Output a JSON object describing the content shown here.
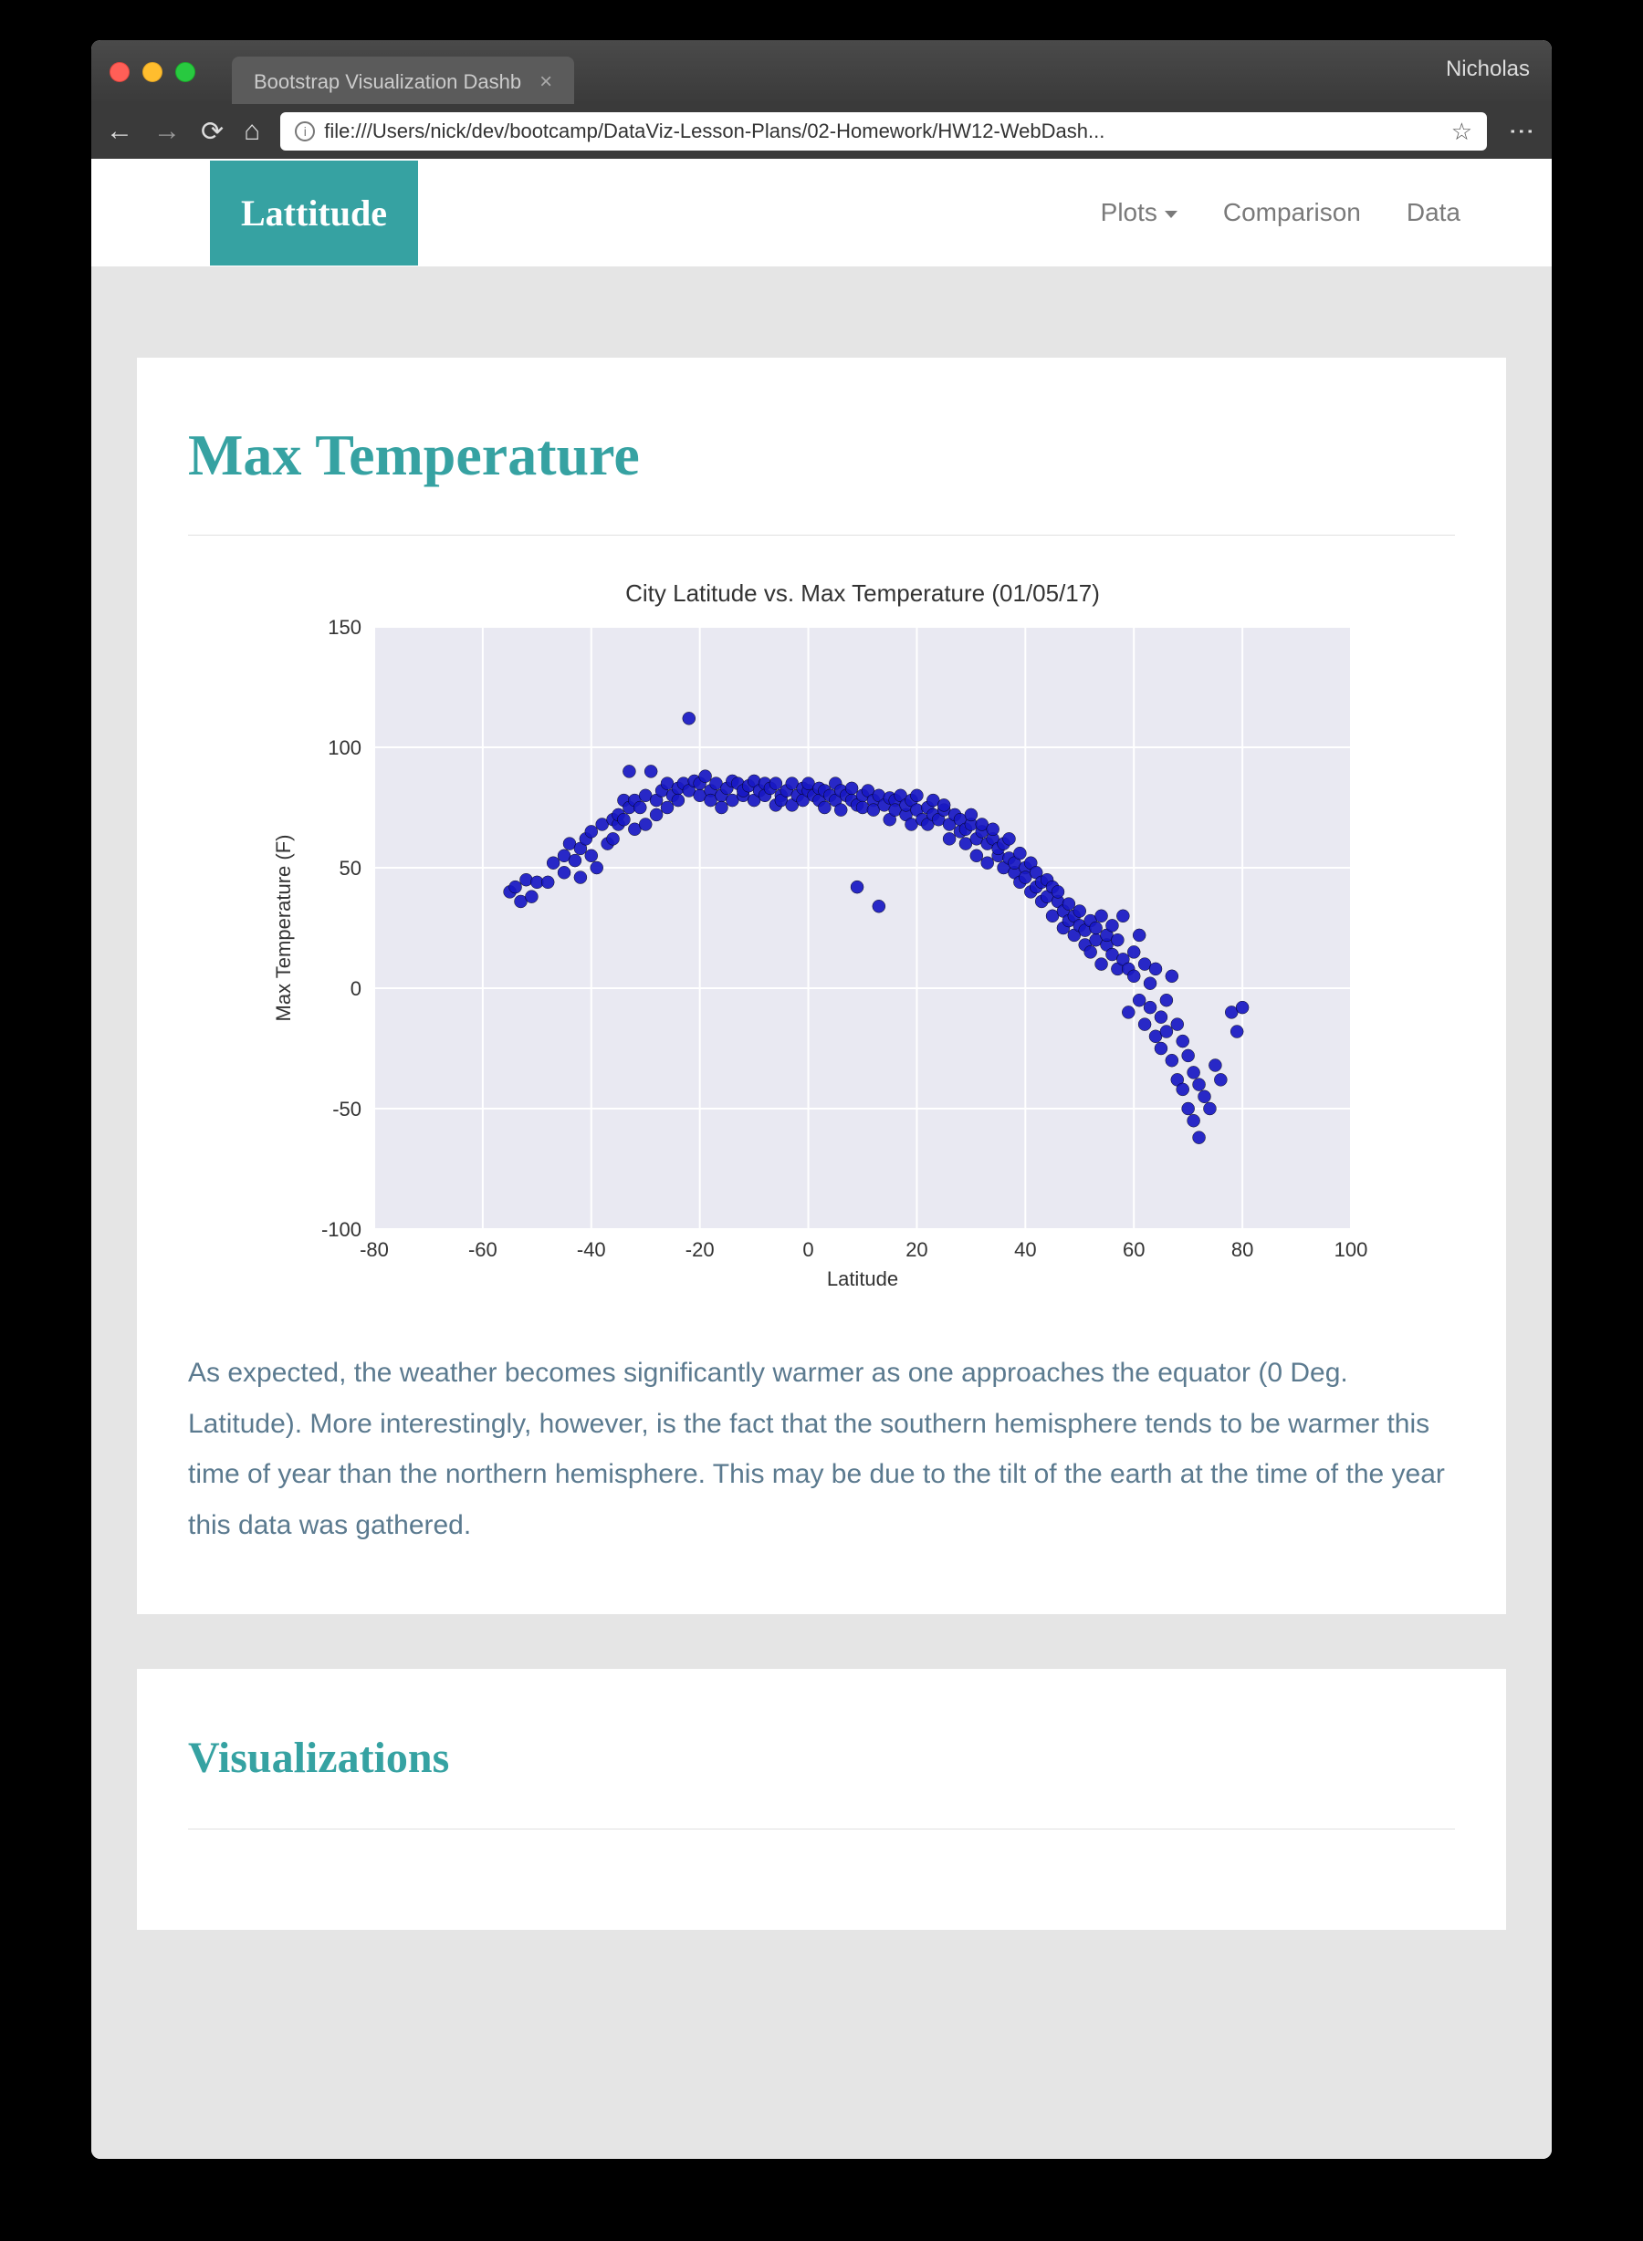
{
  "browser": {
    "tab_title": "Bootstrap Visualization Dashb",
    "user": "Nicholas",
    "url": "file:///Users/nick/dev/bootcamp/DataViz-Lesson-Plans/02-Homework/HW12-WebDash..."
  },
  "navbar": {
    "brand": "Lattitude",
    "links": {
      "plots": "Plots",
      "comparison": "Comparison",
      "data": "Data"
    }
  },
  "main": {
    "title": "Max Temperature",
    "description": "As expected, the weather becomes significantly warmer as one approaches the equator (0 Deg. Latitude). More interestingly, however, is the fact that the southern hemisphere tends to be warmer this time of year than the northern hemisphere. This may be due to the tilt of the earth at the time of the year this data was gathered."
  },
  "sidebar": {
    "title": "Visualizations"
  },
  "chart_data": {
    "type": "scatter",
    "title": "City Latitude vs. Max Temperature (01/05/17)",
    "xlabel": "Latitude",
    "ylabel": "Max Temperature (F)",
    "xlim": [
      -80,
      100
    ],
    "ylim": [
      -100,
      150
    ],
    "xticks": [
      -80,
      -60,
      -40,
      -20,
      0,
      20,
      40,
      60,
      80,
      100
    ],
    "yticks": [
      -100,
      -50,
      0,
      50,
      100,
      150
    ],
    "points": [
      [
        -55,
        40
      ],
      [
        -54,
        42
      ],
      [
        -53,
        36
      ],
      [
        -52,
        45
      ],
      [
        -51,
        38
      ],
      [
        -50,
        44
      ],
      [
        -48,
        44
      ],
      [
        -47,
        52
      ],
      [
        -45,
        55
      ],
      [
        -45,
        48
      ],
      [
        -44,
        60
      ],
      [
        -43,
        53
      ],
      [
        -42,
        58
      ],
      [
        -42,
        46
      ],
      [
        -41,
        62
      ],
      [
        -40,
        55
      ],
      [
        -40,
        65
      ],
      [
        -39,
        50
      ],
      [
        -38,
        68
      ],
      [
        -37,
        60
      ],
      [
        -36,
        62
      ],
      [
        -36,
        70
      ],
      [
        -35,
        68
      ],
      [
        -35,
        72
      ],
      [
        -34,
        70
      ],
      [
        -34,
        78
      ],
      [
        -33,
        90
      ],
      [
        -33,
        75
      ],
      [
        -32,
        66
      ],
      [
        -32,
        78
      ],
      [
        -31,
        75
      ],
      [
        -30,
        68
      ],
      [
        -30,
        80
      ],
      [
        -29,
        90
      ],
      [
        -28,
        78
      ],
      [
        -28,
        72
      ],
      [
        -27,
        82
      ],
      [
        -26,
        85
      ],
      [
        -26,
        75
      ],
      [
        -25,
        80
      ],
      [
        -24,
        83
      ],
      [
        -24,
        78
      ],
      [
        -23,
        85
      ],
      [
        -22,
        82
      ],
      [
        -22,
        112
      ],
      [
        -21,
        86
      ],
      [
        -20,
        80
      ],
      [
        -20,
        85
      ],
      [
        -19,
        88
      ],
      [
        -18,
        82
      ],
      [
        -18,
        78
      ],
      [
        -17,
        85
      ],
      [
        -16,
        80
      ],
      [
        -16,
        75
      ],
      [
        -15,
        83
      ],
      [
        -14,
        86
      ],
      [
        -14,
        78
      ],
      [
        -13,
        85
      ],
      [
        -12,
        80
      ],
      [
        -12,
        82
      ],
      [
        -11,
        84
      ],
      [
        -10,
        86
      ],
      [
        -10,
        78
      ],
      [
        -9,
        82
      ],
      [
        -8,
        85
      ],
      [
        -8,
        80
      ],
      [
        -7,
        83
      ],
      [
        -6,
        76
      ],
      [
        -6,
        85
      ],
      [
        -5,
        80
      ],
      [
        -5,
        78
      ],
      [
        -4,
        82
      ],
      [
        -3,
        85
      ],
      [
        -3,
        76
      ],
      [
        -2,
        80
      ],
      [
        -1,
        83
      ],
      [
        -1,
        78
      ],
      [
        0,
        82
      ],
      [
        0,
        85
      ],
      [
        1,
        80
      ],
      [
        2,
        78
      ],
      [
        2,
        83
      ],
      [
        3,
        82
      ],
      [
        3,
        75
      ],
      [
        4,
        80
      ],
      [
        5,
        85
      ],
      [
        5,
        78
      ],
      [
        6,
        82
      ],
      [
        6,
        74
      ],
      [
        7,
        80
      ],
      [
        8,
        78
      ],
      [
        8,
        83
      ],
      [
        9,
        76
      ],
      [
        9,
        42
      ],
      [
        10,
        80
      ],
      [
        10,
        75
      ],
      [
        11,
        82
      ],
      [
        12,
        78
      ],
      [
        12,
        74
      ],
      [
        13,
        80
      ],
      [
        13,
        34
      ],
      [
        14,
        76
      ],
      [
        15,
        79
      ],
      [
        15,
        70
      ],
      [
        16,
        78
      ],
      [
        16,
        74
      ],
      [
        17,
        80
      ],
      [
        18,
        72
      ],
      [
        18,
        76
      ],
      [
        19,
        78
      ],
      [
        19,
        68
      ],
      [
        20,
        74
      ],
      [
        20,
        80
      ],
      [
        21,
        70
      ],
      [
        22,
        75
      ],
      [
        22,
        68
      ],
      [
        23,
        72
      ],
      [
        23,
        78
      ],
      [
        24,
        70
      ],
      [
        25,
        74
      ],
      [
        25,
        76
      ],
      [
        26,
        68
      ],
      [
        26,
        62
      ],
      [
        27,
        72
      ],
      [
        28,
        65
      ],
      [
        28,
        70
      ],
      [
        29,
        66
      ],
      [
        29,
        60
      ],
      [
        30,
        68
      ],
      [
        30,
        72
      ],
      [
        31,
        62
      ],
      [
        31,
        55
      ],
      [
        32,
        65
      ],
      [
        32,
        68
      ],
      [
        33,
        60
      ],
      [
        33,
        52
      ],
      [
        34,
        62
      ],
      [
        34,
        66
      ],
      [
        35,
        55
      ],
      [
        35,
        58
      ],
      [
        36,
        60
      ],
      [
        36,
        50
      ],
      [
        37,
        54
      ],
      [
        37,
        62
      ],
      [
        38,
        48
      ],
      [
        38,
        52
      ],
      [
        39,
        56
      ],
      [
        39,
        44
      ],
      [
        40,
        50
      ],
      [
        40,
        46
      ],
      [
        41,
        52
      ],
      [
        41,
        40
      ],
      [
        42,
        48
      ],
      [
        42,
        42
      ],
      [
        43,
        44
      ],
      [
        43,
        36
      ],
      [
        44,
        45
      ],
      [
        44,
        38
      ],
      [
        45,
        42
      ],
      [
        45,
        30
      ],
      [
        46,
        36
      ],
      [
        46,
        40
      ],
      [
        47,
        32
      ],
      [
        47,
        25
      ],
      [
        48,
        35
      ],
      [
        48,
        28
      ],
      [
        49,
        30
      ],
      [
        49,
        22
      ],
      [
        50,
        26
      ],
      [
        50,
        32
      ],
      [
        51,
        24
      ],
      [
        51,
        18
      ],
      [
        52,
        28
      ],
      [
        52,
        15
      ],
      [
        53,
        20
      ],
      [
        53,
        25
      ],
      [
        54,
        30
      ],
      [
        54,
        10
      ],
      [
        55,
        18
      ],
      [
        55,
        22
      ],
      [
        56,
        14
      ],
      [
        56,
        26
      ],
      [
        57,
        8
      ],
      [
        57,
        20
      ],
      [
        58,
        30
      ],
      [
        58,
        12
      ],
      [
        59,
        8
      ],
      [
        59,
        -10
      ],
      [
        60,
        15
      ],
      [
        60,
        5
      ],
      [
        61,
        -5
      ],
      [
        61,
        22
      ],
      [
        62,
        10
      ],
      [
        62,
        -15
      ],
      [
        63,
        -8
      ],
      [
        63,
        2
      ],
      [
        64,
        -20
      ],
      [
        64,
        8
      ],
      [
        65,
        -12
      ],
      [
        65,
        -25
      ],
      [
        66,
        -18
      ],
      [
        66,
        -5
      ],
      [
        67,
        -30
      ],
      [
        67,
        5
      ],
      [
        68,
        -15
      ],
      [
        68,
        -38
      ],
      [
        69,
        -22
      ],
      [
        69,
        -42
      ],
      [
        70,
        -28
      ],
      [
        70,
        -50
      ],
      [
        71,
        -35
      ],
      [
        71,
        -55
      ],
      [
        72,
        -40
      ],
      [
        72,
        -62
      ],
      [
        73,
        -45
      ],
      [
        74,
        -50
      ],
      [
        75,
        -32
      ],
      [
        76,
        -38
      ],
      [
        78,
        -10
      ],
      [
        79,
        -18
      ],
      [
        80,
        -8
      ]
    ]
  }
}
